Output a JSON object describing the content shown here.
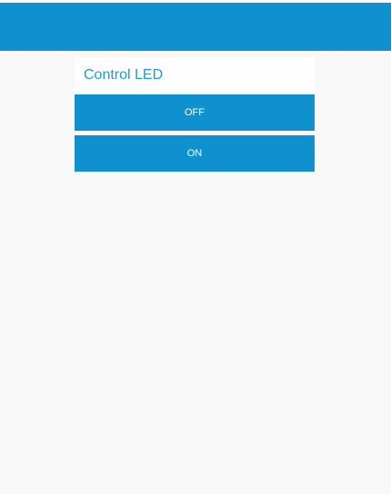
{
  "colors": {
    "accent": "#0f91d0",
    "title": "#1a9ed6",
    "background": "#f8f8f8",
    "panel_header": "#fefefe",
    "button_text": "#ffffff"
  },
  "panel": {
    "title": "Control LED",
    "buttons": [
      {
        "label": "OFF"
      },
      {
        "label": "ON"
      }
    ]
  }
}
